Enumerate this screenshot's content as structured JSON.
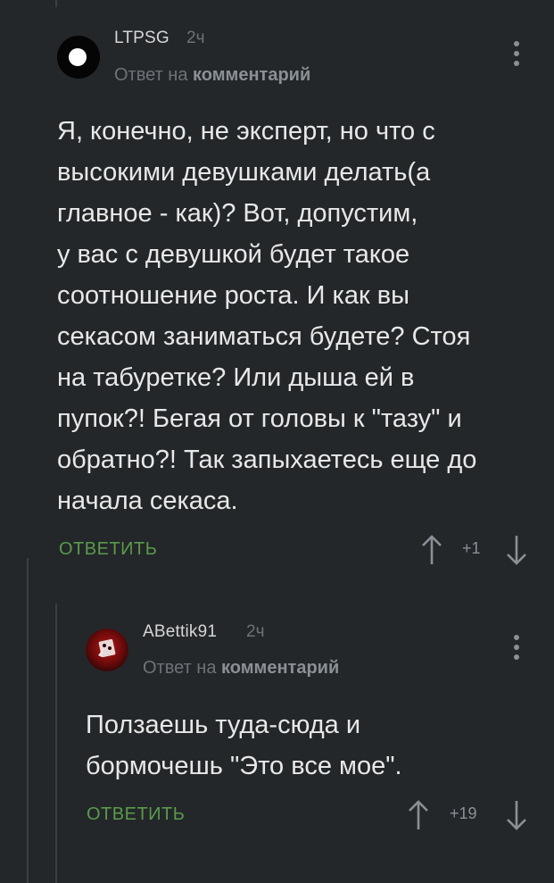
{
  "comment": {
    "username": "LTPSG",
    "time": "2ч",
    "reply_prefix": "Ответ на ",
    "reply_target": "комментарий",
    "text": "Я, конечно, не эксперт, но что с\nвысокими девушками делать(а\nглавное - как)? Вот, допустим,\nу вас с девушкой будет такое\nсоотношение роста. И как вы\nсекасом заниматься будете? Стоя\nна табуретке? Или дыша ей в\nпупок?! Бегая от головы к \"тазу\" и\nобратно?! Так запыхаетесь еще до\nначала секаса.",
    "reply_label": "ОТВЕТИТЬ",
    "rating": "+1"
  },
  "reply": {
    "username": "ABettik91",
    "time": "2ч",
    "reply_prefix": "Ответ на ",
    "reply_target": "комментарий",
    "text": "Ползаешь туда-сюда и\nбормочешь \"Это все мое\".",
    "reply_label": "ОТВЕТИТЬ",
    "rating": "+19"
  },
  "icons": {
    "more": "more-vertical-icon",
    "upvote": "arrow-up-icon",
    "downvote": "arrow-down-icon"
  },
  "colors": {
    "background": "#23272a",
    "accent_green": "#5b9a4a",
    "muted": "#6e7378"
  }
}
